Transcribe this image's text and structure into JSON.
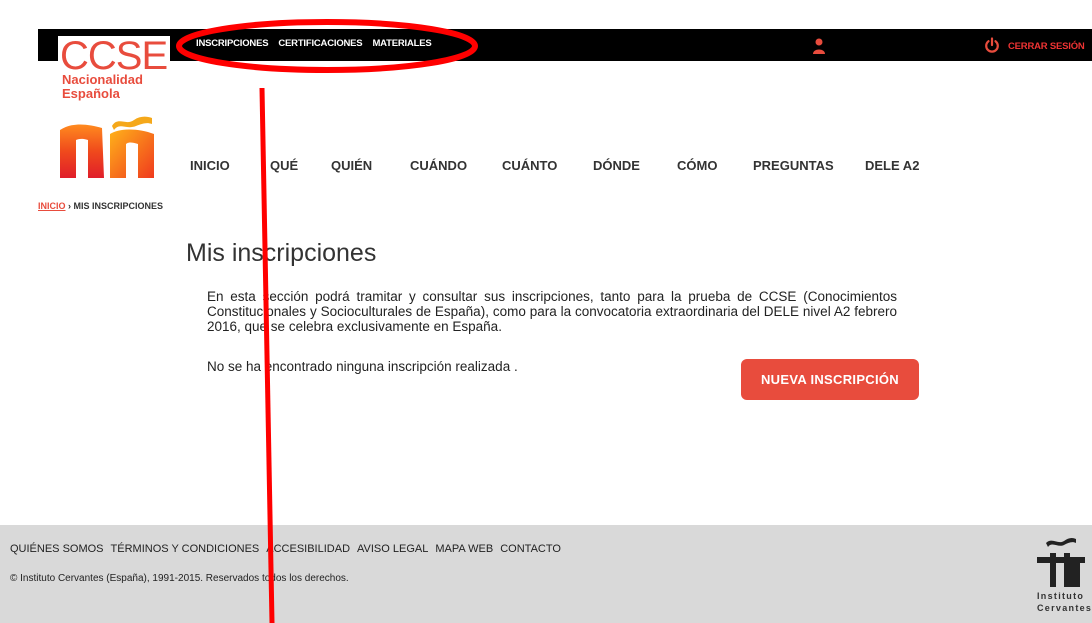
{
  "topbar": {
    "nav": [
      "INSCRIPCIONES",
      "CERTIFICACIONES",
      "MATERIALES"
    ],
    "logout": "CERRAR SESIÓN"
  },
  "logo": {
    "title": "CCSE",
    "sub1": "Nacionalidad",
    "sub2": "Española"
  },
  "mainnav": [
    "INICIO",
    "QUÉ",
    "QUIÉN",
    "CUÁNDO",
    "CUÁNTO",
    "DÓNDE",
    "CÓMO",
    "PREGUNTAS",
    "DELE A2"
  ],
  "breadcrumb": {
    "home": "INICIO",
    "sep": " › ",
    "current": "MIS INSCRIPCIONES"
  },
  "page": {
    "title": "Mis inscripciones",
    "intro": "En esta sección podrá tramitar y consultar sus inscripciones, tanto para la prueba de CCSE (Conocimientos Constitucionales y Socioculturales de España), como para la convocatoria extraordinaria del DELE nivel A2 febrero 2016, que se celebra exclusivamente en España.",
    "empty": "No se ha encontrado ninguna inscripción realizada .",
    "new_button": "NUEVA INSCRIPCIÓN"
  },
  "footer": {
    "links": [
      "QUIÉNES SOMOS",
      "TÉRMINOS Y CONDICIONES",
      "ACCESIBILIDAD",
      "AVISO LEGAL",
      "MAPA WEB",
      "CONTACTO"
    ],
    "copyright": "© Instituto Cervantes (España), 1991-2015. Reservados todos los derechos.",
    "brand1": "Instituto",
    "brand2": "Cervantes"
  },
  "colors": {
    "accent": "#e84c3d",
    "topbar": "#000000",
    "footer": "#d9d9d9",
    "annotation": "#ff0000"
  }
}
